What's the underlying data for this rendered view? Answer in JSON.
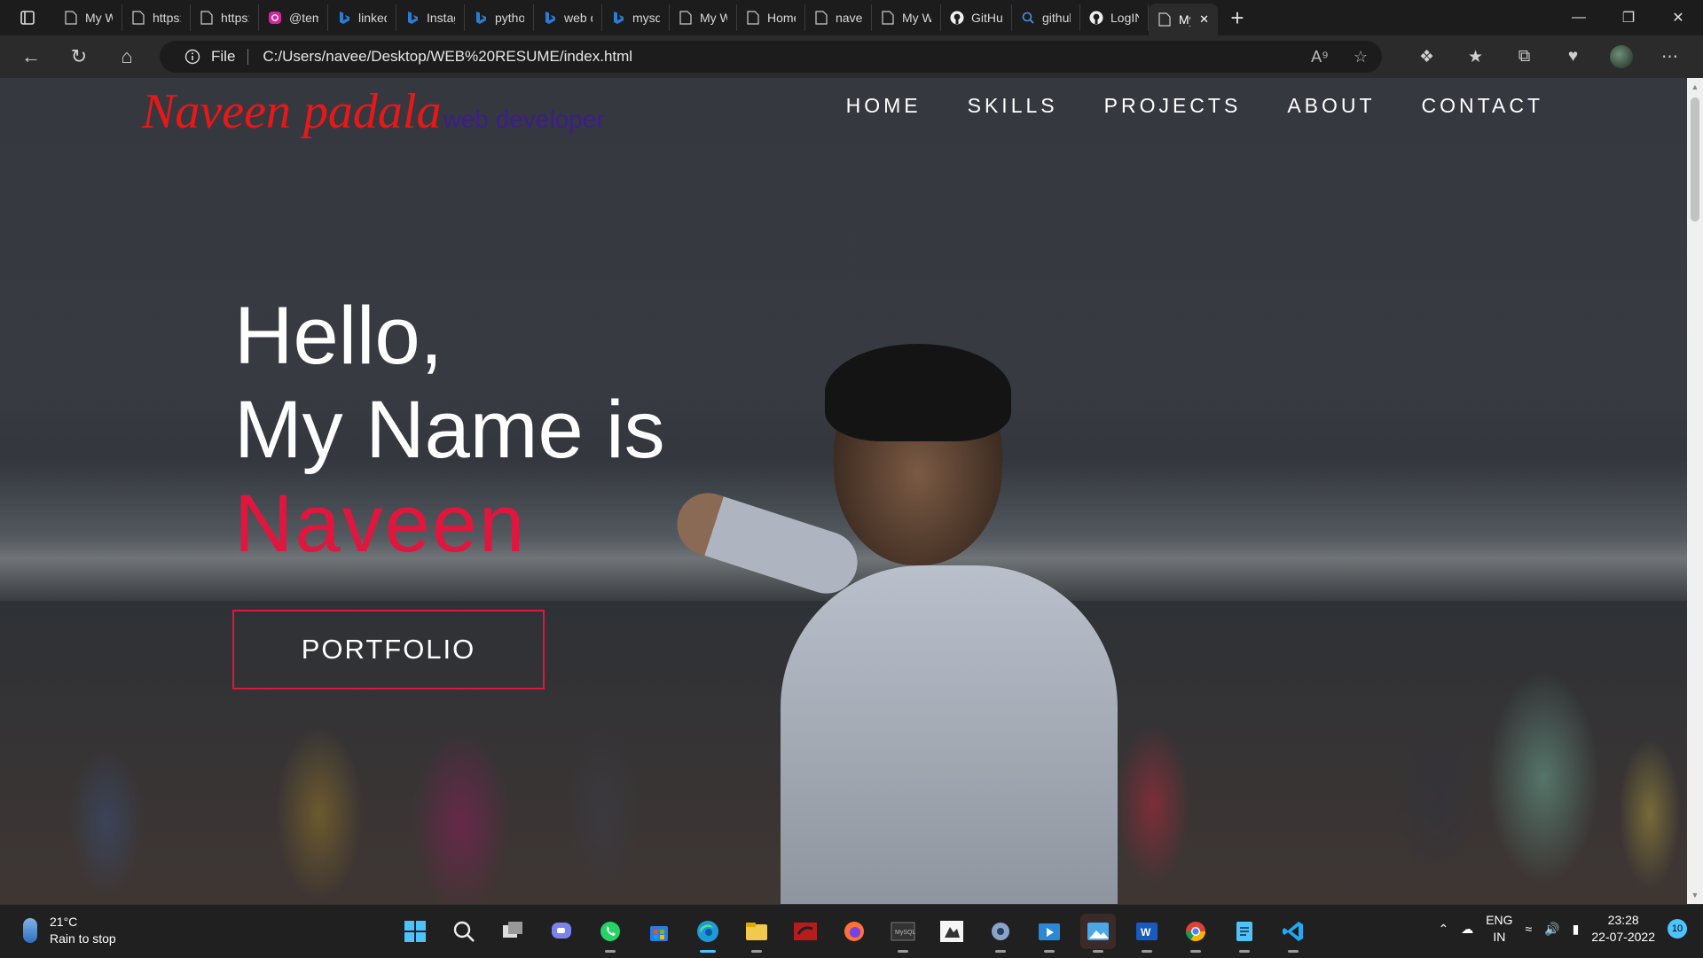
{
  "browser": {
    "tabs": [
      {
        "title": "My We",
        "icon": "page-icon"
      },
      {
        "title": "https:/",
        "icon": "page-icon"
      },
      {
        "title": "https:/",
        "icon": "page-icon"
      },
      {
        "title": "@temp",
        "icon": "instagram-icon"
      },
      {
        "title": "linkedi",
        "icon": "bing-icon"
      },
      {
        "title": "Instagr",
        "icon": "bing-icon"
      },
      {
        "title": "python",
        "icon": "bing-icon"
      },
      {
        "title": "web de",
        "icon": "bing-icon"
      },
      {
        "title": "mysql",
        "icon": "bing-icon"
      },
      {
        "title": "My We",
        "icon": "page-icon"
      },
      {
        "title": "Home",
        "icon": "page-icon"
      },
      {
        "title": "naveen",
        "icon": "page-icon"
      },
      {
        "title": "My We",
        "icon": "page-icon"
      },
      {
        "title": "GitHub",
        "icon": "github-icon"
      },
      {
        "title": "github",
        "icon": "search-icon"
      },
      {
        "title": "LogIN",
        "icon": "github-icon"
      },
      {
        "title": "My",
        "icon": "page-icon",
        "active": true
      }
    ],
    "address": {
      "scheme_label": "File",
      "url": "C:/Users/navee/Desktop/WEB%20RESUME/index.html"
    }
  },
  "site": {
    "brand_name": "Naveen padala",
    "brand_role": "web developer",
    "nav": [
      "HOME",
      "SKILLS",
      "PROJECTS",
      "ABOUT",
      "CONTACT"
    ],
    "hero": {
      "line1": "Hello,",
      "line2": "My Name is",
      "line3": "Naveen"
    },
    "cta_label": "PORTFOLIO",
    "colors": {
      "accent": "#e0163f",
      "brand": "#e81818",
      "role": "#3c1d8a"
    }
  },
  "taskbar": {
    "weather_temp": "21°C",
    "weather_desc": "Rain to stop",
    "apps": [
      "windows-start-icon",
      "search-icon",
      "task-view-icon",
      "teams-chat-icon",
      "whatsapp-icon",
      "store-icon",
      "edge-icon",
      "file-explorer-icon",
      "mysql-workbench-icon",
      "firefox-icon",
      "mysql-shell-icon",
      "inkscape-icon",
      "settings-icon",
      "media-player-icon",
      "photos-icon",
      "word-icon",
      "chrome-icon",
      "notepad-icon",
      "vscode-icon"
    ],
    "lang_line1": "ENG",
    "lang_line2": "IN",
    "time": "23:28",
    "date": "22-07-2022",
    "notification_count": "10"
  }
}
